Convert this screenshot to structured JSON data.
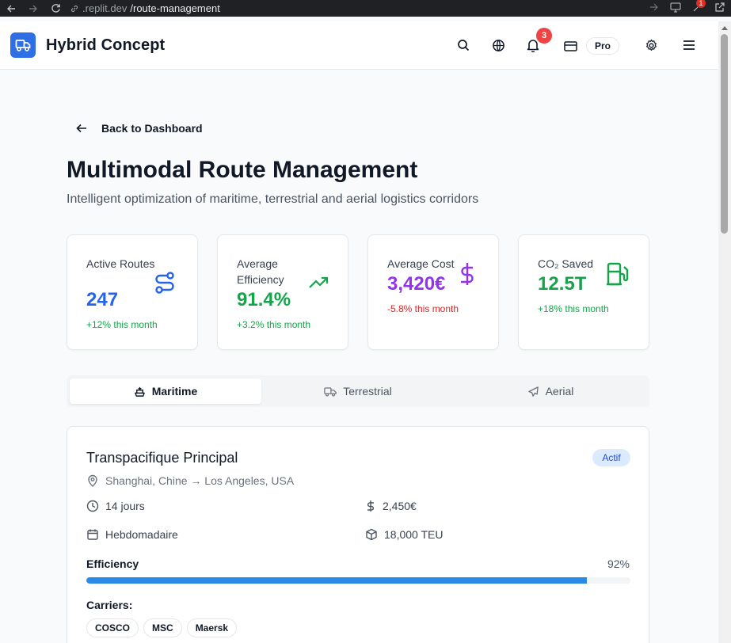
{
  "browser": {
    "url_host": ".replit.dev",
    "url_path": "/route-management",
    "ext_badge": "1"
  },
  "header": {
    "brand": "Hybrid Concept",
    "notification_count": "3",
    "plan_label": "Pro"
  },
  "back_link": {
    "label": "Back to Dashboard"
  },
  "page": {
    "title": "Multimodal Route Management",
    "subtitle": "Intelligent optimization of maritime, terrestrial and aerial logistics corridors"
  },
  "stats": [
    {
      "label": "Active Routes",
      "value": "247",
      "change": "+12% this month",
      "color": "#2563eb",
      "change_color": "#16a34a",
      "icon": "route-icon"
    },
    {
      "label": "Average Efficiency",
      "value": "91.4%",
      "change": "+3.2% this month",
      "color": "#16a34a",
      "change_color": "#16a34a",
      "icon": "trending-up-icon"
    },
    {
      "label": "Average Cost",
      "value": "3,420€",
      "change": "-5.8% this month",
      "color": "#9333ea",
      "change_color": "#dc2626",
      "icon": "dollar-icon"
    },
    {
      "label": "CO₂ Saved",
      "value": "12.5T",
      "change": "+18% this month",
      "color": "#16a34a",
      "change_color": "#16a34a",
      "icon": "fuel-icon"
    }
  ],
  "tabs": [
    {
      "label": "Maritime",
      "icon": "ship-icon",
      "active": true
    },
    {
      "label": "Terrestrial",
      "icon": "truck-icon",
      "active": false
    },
    {
      "label": "Aerial",
      "icon": "plane-icon",
      "active": false
    }
  ],
  "route": {
    "name": "Transpacifique Principal",
    "status": "Actif",
    "origin_destination": "Shanghai, Chine → Los Angeles, USA",
    "duration": "14 jours",
    "cost": "2,450€",
    "frequency": "Hebdomadaire",
    "capacity": "18,000 TEU",
    "efficiency_label": "Efficiency",
    "efficiency_value": "92%",
    "efficiency_fraction": 0.92,
    "carriers_label": "Carriers:",
    "carriers": [
      "COSCO",
      "MSC",
      "Maersk"
    ]
  },
  "colors": {
    "accent": "#2f6fe5",
    "progress": "#2b8ae6"
  }
}
